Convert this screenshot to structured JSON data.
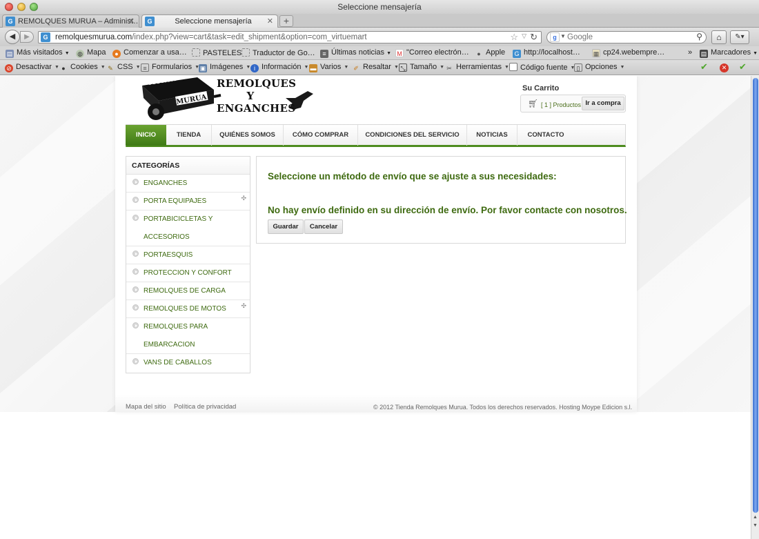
{
  "window": {
    "title": "Seleccione mensajería"
  },
  "tabs": [
    {
      "label": "REMOLQUES MURUA – Administ…",
      "active": false
    },
    {
      "label": "Seleccione mensajería",
      "active": true
    }
  ],
  "nav": {
    "url_host": "remolquesmurua.com",
    "url_path": "/index.php?view=cart&task=edit_shipment&option=com_virtuemart",
    "search_placeholder": "Google",
    "search_engine_icon": "google-icon"
  },
  "bookmarks": [
    {
      "label": "Más visitados",
      "icon": "bookmarks-folder-icon",
      "menu": true
    },
    {
      "label": "Mapa",
      "icon": "globe-icon"
    },
    {
      "label": "Comenzar a usa…",
      "icon": "firefox-icon"
    },
    {
      "label": "PASTELES",
      "icon": "page-icon"
    },
    {
      "label": "Traductor de Go…",
      "icon": "page-icon"
    },
    {
      "label": "Últimas noticias",
      "icon": "rss-icon",
      "menu": true
    },
    {
      "label": "\"Correo electrón…",
      "icon": "gmail-icon"
    },
    {
      "label": "Apple",
      "icon": "apple-icon"
    },
    {
      "label": "http://localhost…",
      "icon": "g-icon"
    },
    {
      "label": "cp24.webempre…",
      "icon": "page-icon"
    },
    {
      "label": "Marcadores",
      "icon": "bookmarks-icon",
      "menu": true
    }
  ],
  "webdev_toolbar": [
    {
      "label": "Desactivar",
      "icon": "disable-icon"
    },
    {
      "label": "Cookies",
      "icon": "cookie-icon"
    },
    {
      "label": "CSS",
      "icon": "pencil-icon"
    },
    {
      "label": "Formularios",
      "icon": "form-icon"
    },
    {
      "label": "Imágenes",
      "icon": "image-icon"
    },
    {
      "label": "Información",
      "icon": "info-icon"
    },
    {
      "label": "Varios",
      "icon": "toolbox-icon"
    },
    {
      "label": "Resaltar",
      "icon": "highlighter-icon"
    },
    {
      "label": "Tamaño",
      "icon": "resize-icon"
    },
    {
      "label": "Herramientas",
      "icon": "tools-icon"
    },
    {
      "label": "Código fuente",
      "icon": "source-icon"
    },
    {
      "label": "Opciones",
      "icon": "options-icon"
    }
  ],
  "page": {
    "logo": {
      "line1": "REMOLQUES",
      "line2": "Y",
      "line3": "ENGANCHES",
      "trailer_text_top": "MURUA",
      "trailer_text_side": "MURUA"
    },
    "cart": {
      "title": "Su Carrito",
      "count_text": "[ 1 ] Productos",
      "checkout_label": "Ir a compra"
    },
    "menu": [
      {
        "label": "INICIO",
        "active": true
      },
      {
        "label": "TIENDA"
      },
      {
        "label": "QUIÉNES SOMOS"
      },
      {
        "label": "CÓMO COMPRAR"
      },
      {
        "label": "CONDICIONES DEL SERVICIO"
      },
      {
        "label": "NOTICIAS"
      },
      {
        "label": "CONTACTO"
      }
    ],
    "sidebar": {
      "title": "CATEGORÍAS",
      "items": [
        {
          "label": "ENGANCHES"
        },
        {
          "label": "PORTA EQUIPAJES",
          "expandable": true
        },
        {
          "label": "PORTABICICLETAS Y",
          "label2": "ACCESORIOS"
        },
        {
          "label": "PORTAESQUIS"
        },
        {
          "label": "PROTECCION Y CONFORT"
        },
        {
          "label": "REMOLQUES DE CARGA"
        },
        {
          "label": "REMOLQUES DE MOTOS",
          "expandable": true
        },
        {
          "label": "REMOLQUES PARA",
          "label2": "EMBARCACION"
        },
        {
          "label": "VANS DE CABALLOS"
        }
      ]
    },
    "content": {
      "heading": "Seleccione un método de envío que se ajuste a sus necesidades:",
      "message": "No hay envío definido en su dirección de envío. Por favor contacte con nosotros.",
      "save_label": "Guardar",
      "cancel_label": "Cancelar"
    },
    "footer": {
      "sitemap": "Mapa del sitio",
      "privacy": "Política de privacidad",
      "copyright": "© 2012 Tienda Remolques Murua. Todos los derechos reservados. Hosting Moype Edicion s.l."
    }
  },
  "colors": {
    "brand_green": "#4d8b1e",
    "link_green": "#3e6a10",
    "scroll_blue": "#3a6fd0"
  }
}
